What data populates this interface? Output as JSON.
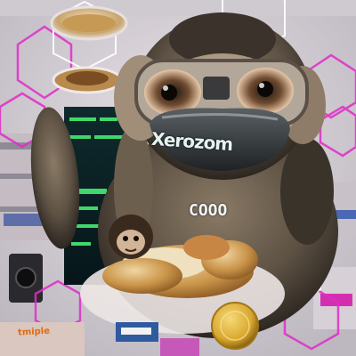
{
  "image": {
    "subject": "furry monkey wearing goggles and a mask behind a plate of bread rolls in a cluttered electronics shop",
    "texts": {
      "mask": "Xerozom",
      "screen": "COOO",
      "shelf_sign": "tmiple"
    },
    "colors": {
      "fur_light": "#cdbba4",
      "fur_dark": "#2c2620",
      "mask_dark": "#2a2e30",
      "screen_green": "#3fd96b",
      "accent_magenta": "#e02cc8",
      "bread": "#c99348",
      "coin_gold": "#d9a82e"
    }
  }
}
